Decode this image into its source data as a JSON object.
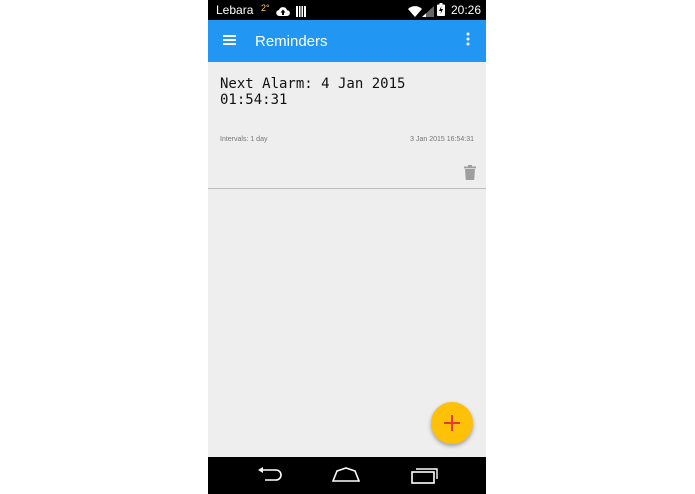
{
  "status_bar": {
    "carrier": "Lebara",
    "temperature": "2°",
    "time": "20:26",
    "icons": [
      "cloud-upload-icon",
      "barcode-icon",
      "wifi-icon",
      "cell-signal-icon",
      "battery-charging-icon"
    ]
  },
  "toolbar": {
    "title": "Reminders",
    "menu_icon": "hamburger-menu-icon",
    "overflow_icon": "more-vert-icon",
    "color": "#2196f3"
  },
  "reminder": {
    "next_alarm": "Next Alarm: 4 Jan 2015\n01:54:31",
    "intervals": "Intervals: 1 day",
    "created": "3 Jan 2015 16:54:31",
    "delete_icon": "trash-icon"
  },
  "fab": {
    "icon": "plus-icon",
    "color": "#ffc107",
    "icon_color": "#e53935"
  },
  "nav_bar": {
    "icons": [
      "back-icon",
      "home-icon",
      "recents-icon"
    ]
  }
}
